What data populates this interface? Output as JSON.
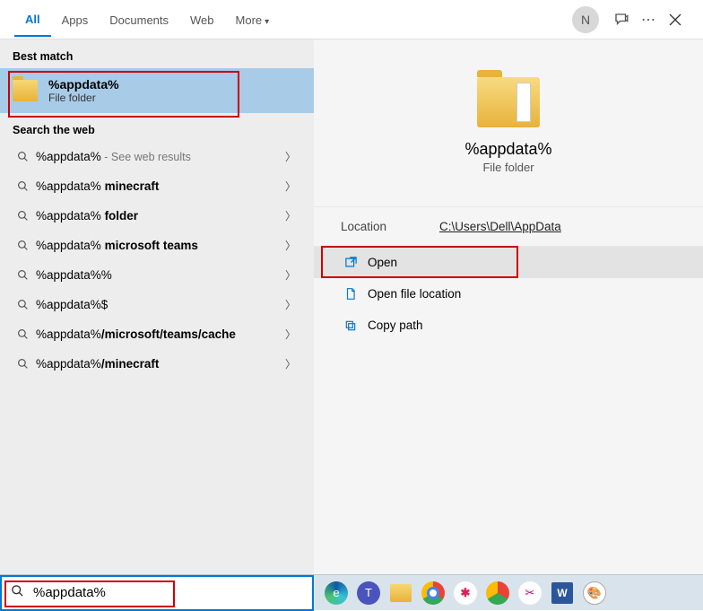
{
  "tabs": {
    "all": "All",
    "apps": "Apps",
    "documents": "Documents",
    "web": "Web",
    "more": "More"
  },
  "avatar_initial": "N",
  "sections": {
    "best_match": "Best match",
    "search_web": "Search the web"
  },
  "best_match": {
    "title": "%appdata%",
    "subtitle": "File folder"
  },
  "web_results": [
    {
      "q": "%appdata%",
      "suffix": "",
      "hint": " - See web results",
      "bold": false
    },
    {
      "q": "%appdata%",
      "suffix": " minecraft",
      "hint": "",
      "bold": true
    },
    {
      "q": "%appdata%",
      "suffix": " folder",
      "hint": "",
      "bold": true
    },
    {
      "q": "%appdata%",
      "suffix": " microsoft teams",
      "hint": "",
      "bold": true
    },
    {
      "q": "%appdata%",
      "suffix": "%",
      "hint": "",
      "bold": false
    },
    {
      "q": "%appdata%",
      "suffix": "$",
      "hint": "",
      "bold": false
    },
    {
      "q": "%appdata%",
      "suffix": "/microsoft/teams/cache",
      "hint": "",
      "bold": true
    },
    {
      "q": "%appdata%",
      "suffix": "/minecraft",
      "hint": "",
      "bold": true
    }
  ],
  "preview": {
    "title": "%appdata%",
    "subtitle": "File folder",
    "location_label": "Location",
    "location_value": "C:\\Users\\Dell\\AppData"
  },
  "actions": {
    "open": "Open",
    "open_loc": "Open file location",
    "copy_path": "Copy path"
  },
  "search_value": "%appdata%"
}
